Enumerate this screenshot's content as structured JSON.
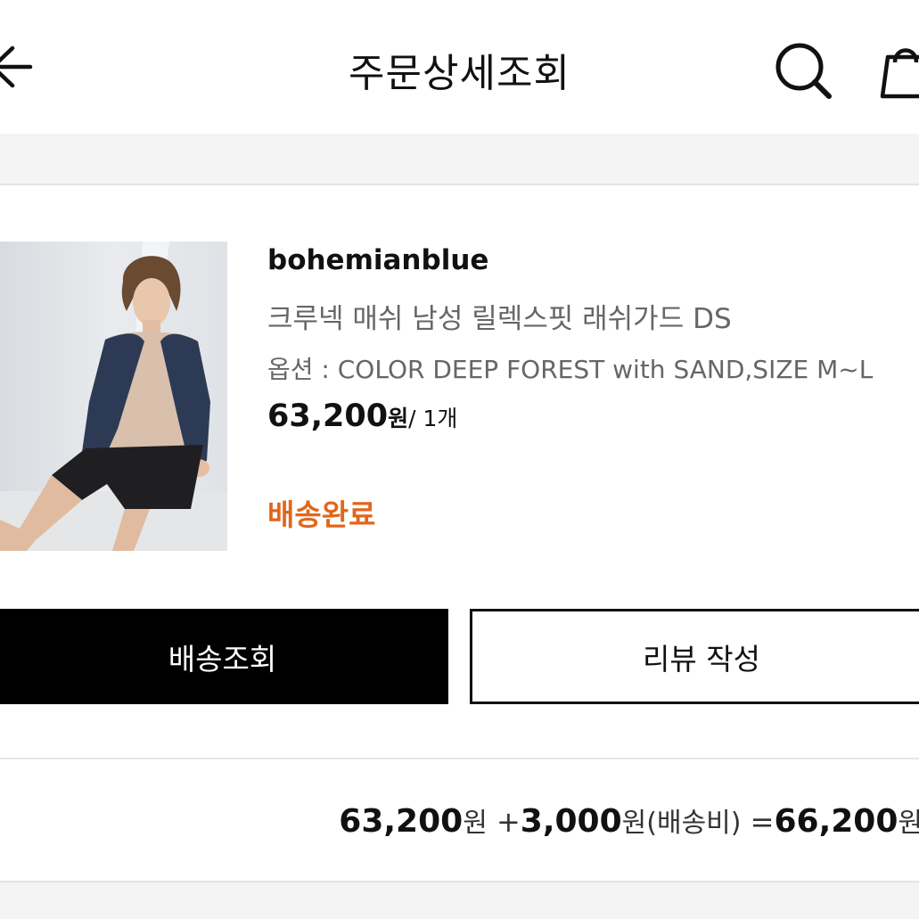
{
  "header": {
    "title": "주문상세조회",
    "back_icon": "arrow-left-icon",
    "search_icon": "search-icon",
    "cart_icon": "shopping-bag-icon"
  },
  "product": {
    "brand": "bohemianblue",
    "name": "크루넥 매쉬 남성 릴렉스핏 래쉬가드 DS",
    "option": "옵션 : COLOR DEEP FOREST with SAND,SIZE M~L",
    "price": "63,200",
    "price_unit": "원",
    "quantity": "/ 1개",
    "status": "배송완료",
    "status_color": "#e2661a"
  },
  "buttons": {
    "track_label": "배송조회",
    "review_label": "리뷰 작성"
  },
  "summary": {
    "item_price": "63,200",
    "won1": "원",
    "plus": " +",
    "shipping_price": "3,000",
    "won2": "원",
    "shipping_label": "(배송비)",
    "equals": " =",
    "total_price": "66,200",
    "won3": "원"
  }
}
